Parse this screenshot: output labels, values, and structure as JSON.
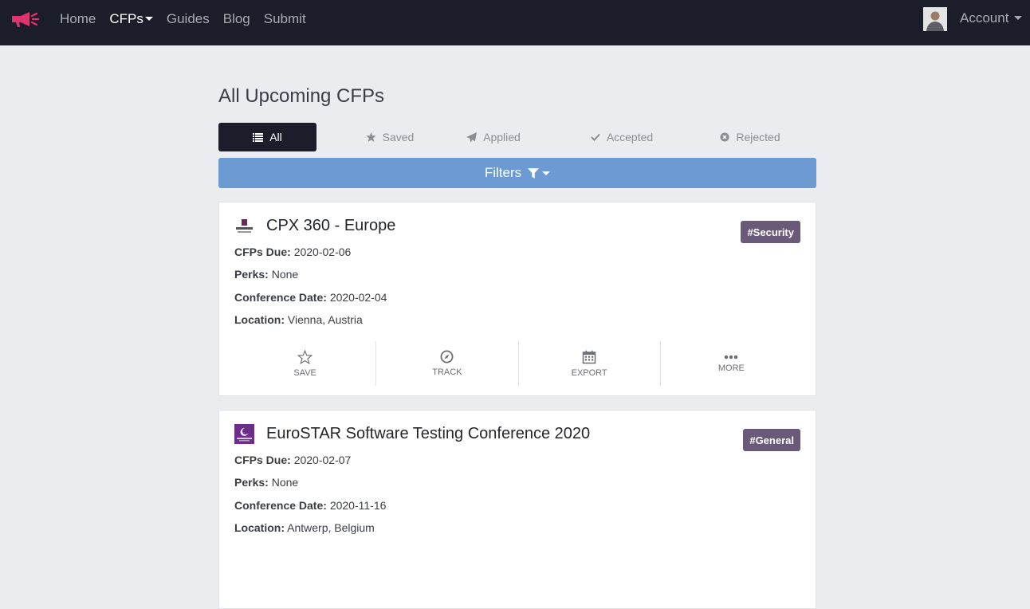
{
  "nav": {
    "links": [
      {
        "label": "Home"
      },
      {
        "label": "CFPs"
      },
      {
        "label": "Guides"
      },
      {
        "label": "Blog"
      },
      {
        "label": "Submit"
      }
    ],
    "account_label": "Account"
  },
  "page": {
    "title": "All Upcoming CFPs"
  },
  "tabs": [
    {
      "label": "All",
      "icon": "list-icon"
    },
    {
      "label": "Saved",
      "icon": "star-icon"
    },
    {
      "label": "Applied",
      "icon": "paper-plane-icon"
    },
    {
      "label": "Accepted",
      "icon": "check-icon"
    },
    {
      "label": "Rejected",
      "icon": "x-circle-icon"
    }
  ],
  "filters": {
    "label": "Filters"
  },
  "field_labels": {
    "due": "CFPs Due:",
    "perks": "Perks:",
    "conference_date": "Conference Date:",
    "location": "Location:"
  },
  "actions": [
    {
      "label": "SAVE",
      "icon": "star-outline-icon"
    },
    {
      "label": "TRACK",
      "icon": "compass-icon"
    },
    {
      "label": "EXPORT",
      "icon": "calendar-icon"
    },
    {
      "label": "MORE",
      "icon": "ellipsis-icon"
    }
  ],
  "cards": [
    {
      "title": "CPX 360 - Europe",
      "tag": "#Security",
      "due": "2020-02-06",
      "perks": "None",
      "conference_date": "2020-02-04",
      "location": "Vienna, Austria"
    },
    {
      "title": "EuroSTAR Software Testing Conference 2020",
      "tag": "#General",
      "due": "2020-02-07",
      "perks": "None",
      "conference_date": "2020-11-16",
      "location": "Antwerp, Belgium"
    }
  ],
  "colors": {
    "navbar": "#1b1d2a",
    "filters": "#6c9bd3",
    "tag": "#6a5a7a",
    "brand": "#e0336f"
  }
}
